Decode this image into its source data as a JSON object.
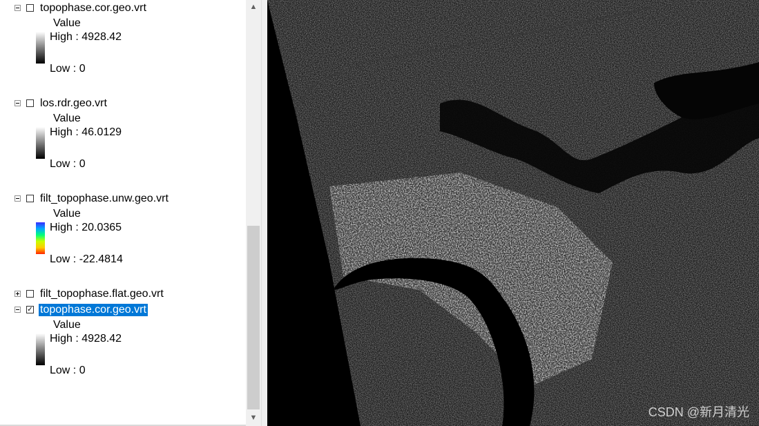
{
  "toc": {
    "layers": [
      {
        "name": "topophase.cor.geo.vrt",
        "expanded": true,
        "checked": false,
        "selected": false,
        "value_label": "Value",
        "high": "High : 4928.42",
        "low": "Low : 0",
        "ramp": "grayscale"
      },
      {
        "name": "los.rdr.geo.vrt",
        "expanded": true,
        "checked": false,
        "selected": false,
        "value_label": "Value",
        "high": "High : 46.0129",
        "low": "Low : 0",
        "ramp": "grayscale"
      },
      {
        "name": "filt_topophase.unw.geo.vrt",
        "expanded": true,
        "checked": false,
        "selected": false,
        "value_label": "Value",
        "high": "High : 20.0365",
        "low": "Low : -22.4814",
        "ramp": "rainbow"
      },
      {
        "name": "filt_topophase.flat.geo.vrt",
        "expanded": false,
        "checked": false,
        "selected": false
      },
      {
        "name": "topophase.cor.geo.vrt",
        "expanded": true,
        "checked": true,
        "selected": true,
        "value_label": "Value",
        "high": "High : 4928.42",
        "low": "Low : 0",
        "ramp": "grayscale"
      }
    ]
  },
  "map": {
    "watermark": "CSDN @新月清光"
  }
}
